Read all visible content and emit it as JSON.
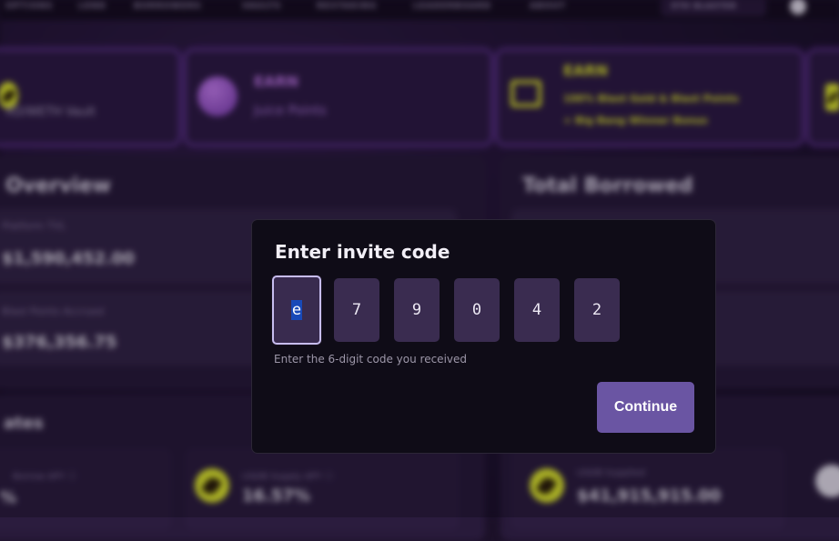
{
  "background": {
    "nav": [
      "OPTIONS",
      "LEND",
      "BORROWERS",
      "VAULTS",
      "RESTAKING",
      "LEADERBOARD",
      "ABOUT"
    ],
    "nav_button": "ETH BLASTER",
    "promo_cards": [
      {
        "title": "",
        "subtitle": "XD/WETH Vault"
      },
      {
        "title": "EARN",
        "subtitle": "Juice Points"
      },
      {
        "title": "EARN",
        "subtitle": "100% Blast Gold & Blast Points",
        "subtitle2": "+ Big Bang Winner Bonus"
      }
    ],
    "overview": {
      "title": "Overview",
      "stat1_label": "Platform TVL",
      "stat1_value": "$1,590,452.00",
      "stat2_label": "Blast Points Accrued",
      "stat2_value": "$376,356.75"
    },
    "total_borrowed": {
      "title": "Total Borrowed"
    },
    "rates": {
      "title": "ates",
      "tile1_label": "Borrow APY ⓘ",
      "tile1_value": "%",
      "tile2_label": "USDB Supply APY ⓘ",
      "tile2_value": "16.57%",
      "tile3_label": "USDB Supplied",
      "tile3_value": "$41,915,915.00"
    }
  },
  "modal": {
    "title": "Enter invite code",
    "digits": [
      "e",
      "7",
      "9",
      "0",
      "4",
      "2"
    ],
    "helper": "Enter the 6-digit code you received",
    "continue_label": "Continue"
  },
  "colors": {
    "modal_bg": "#0f0c17",
    "digit_bg": "#3a2c50",
    "button_bg": "#6a55a3",
    "selection": "#1849b8",
    "accent_yellow": "#e6f02e",
    "accent_purple": "#c87bf0"
  }
}
